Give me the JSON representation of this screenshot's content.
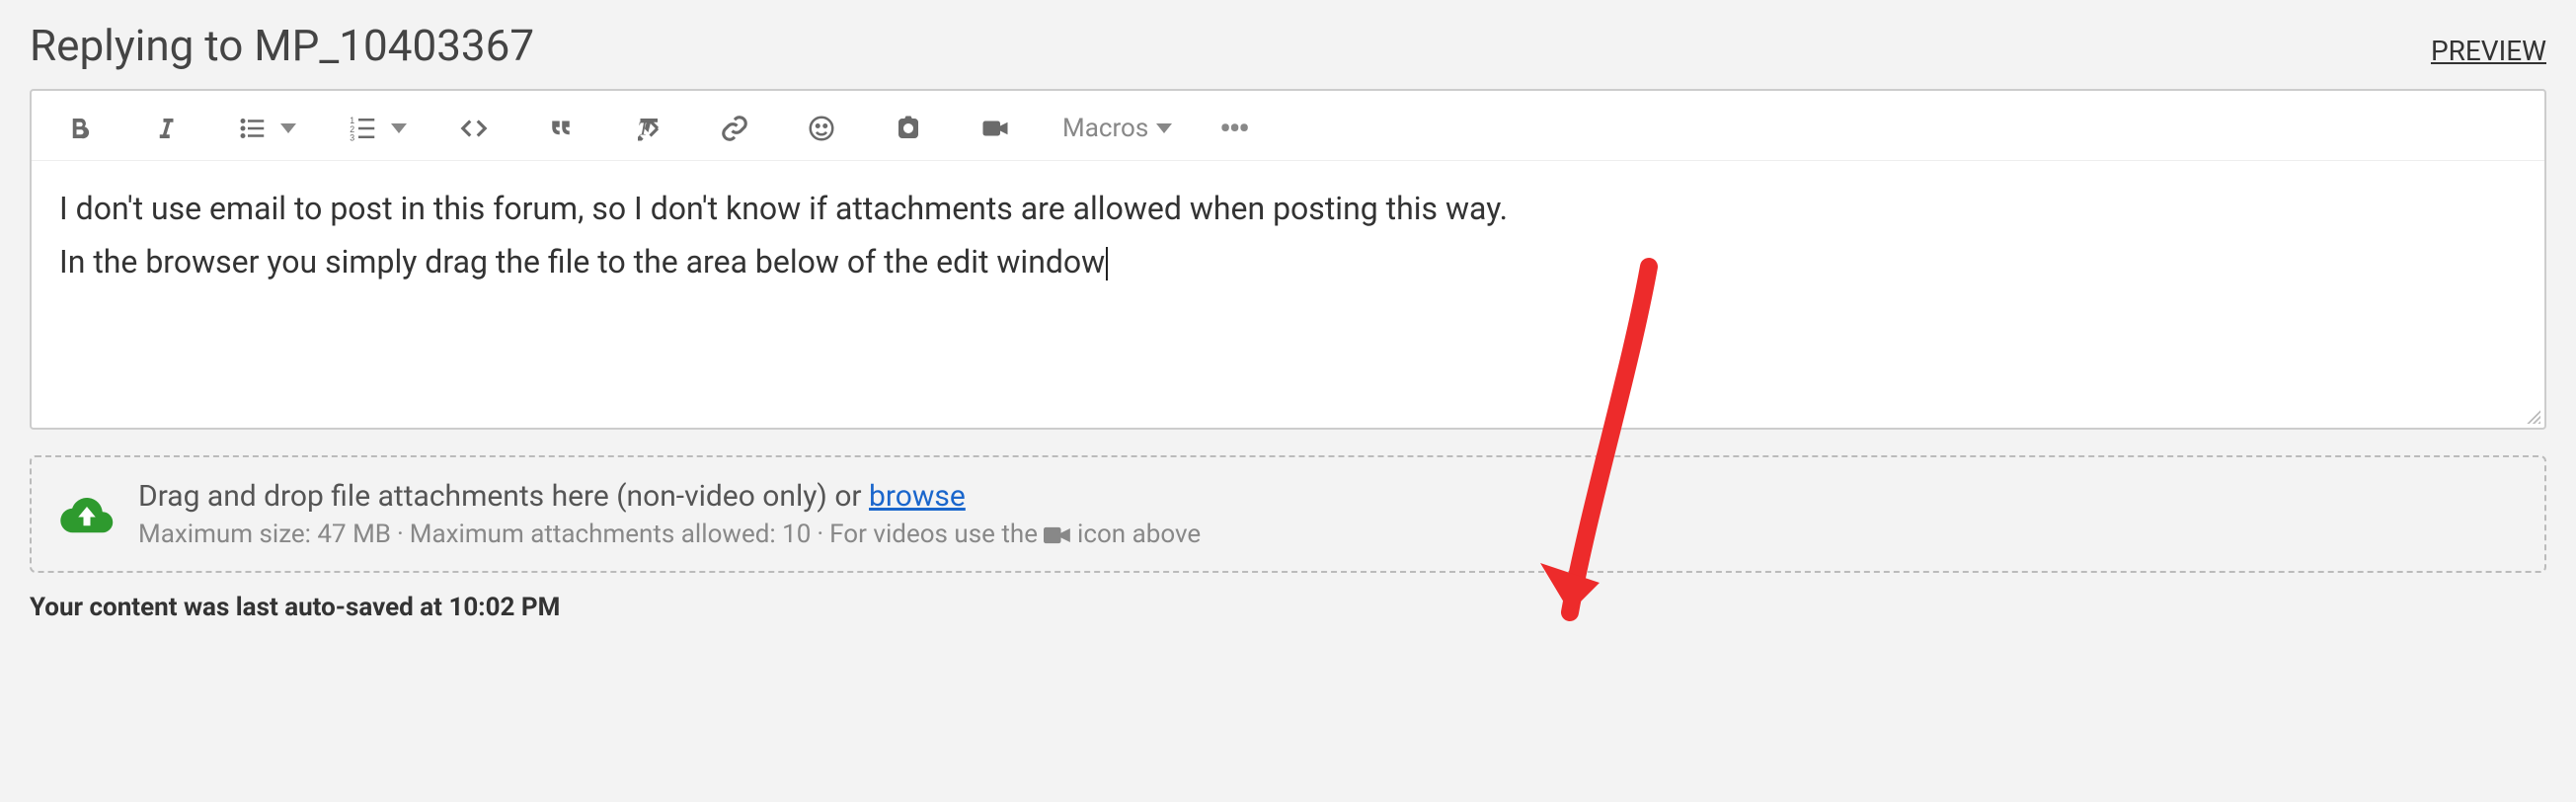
{
  "header": {
    "title": "Replying to MP_10403367",
    "preview_label": "PREVIEW"
  },
  "toolbar": {
    "macros_label": "Macros"
  },
  "editor": {
    "line1": "I don't use email to post in this forum, so I don't know if attachments are allowed when posting this way.",
    "line2": "In the browser you simply drag the file to the area below of the edit window"
  },
  "dropzone": {
    "prompt_prefix": "Drag and drop file attachments here (non-video only) or ",
    "browse_label": "browse",
    "max_size_label": "Maximum size: 47 MB",
    "sep": " · ",
    "max_attach_label": "Maximum attachments allowed: 10",
    "video_hint_prefix": "For videos use the ",
    "video_hint_suffix": " icon above"
  },
  "autosave": {
    "prefix": "Your content was last auto-saved at ",
    "time": "10:02 PM"
  },
  "colors": {
    "accent_green": "#2e9a2e",
    "link_blue": "#1a66cc",
    "annotation_red": "#ed2b2b"
  }
}
